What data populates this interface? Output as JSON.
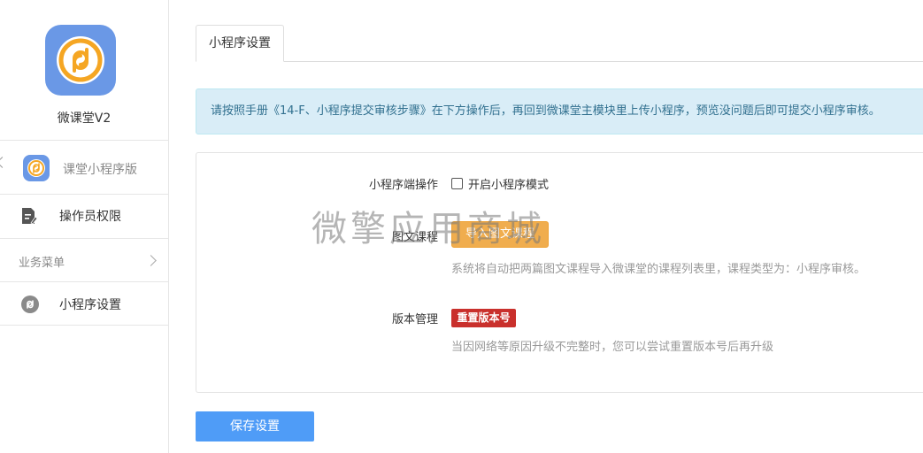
{
  "sidebar": {
    "app_name": "微课堂V2",
    "current_module": "课堂小程序版",
    "operator_permissions": "操作员权限",
    "group_label": "业务菜单",
    "miniprogram_settings": "小程序设置"
  },
  "tabs": [
    {
      "label": "小程序设置"
    }
  ],
  "notice": "请按照手册《14-F、小程序提交审核步骤》在下方操作后，再回到微课堂主模块里上传小程序，预览没问题后即可提交小程序审核。",
  "form": {
    "mp_mode_label": "小程序端操作",
    "mp_mode_checkbox": "开启小程序模式",
    "mp_mode_checked": false,
    "graphic_course_label": "图文课程",
    "import_button": "导入图文课程",
    "import_help": "系统将自动把两篇图文课程导入微课堂的课程列表里，课程类型为：小程序审核。",
    "version_label": "版本管理",
    "reset_button": "重置版本号",
    "reset_help": "当因网络等原因升级不完整时，您可以尝试重置版本号后再升级"
  },
  "save_button": "保存设置",
  "watermark": "微擎应用商城",
  "colors": {
    "logo_bg": "#6a98e6",
    "logo_ring": "#f5a623",
    "notice_bg": "#d9edf7",
    "import_btn": "#f0ad4e",
    "reset_btn": "#c9302c",
    "save_btn": "#4f9cf7"
  }
}
